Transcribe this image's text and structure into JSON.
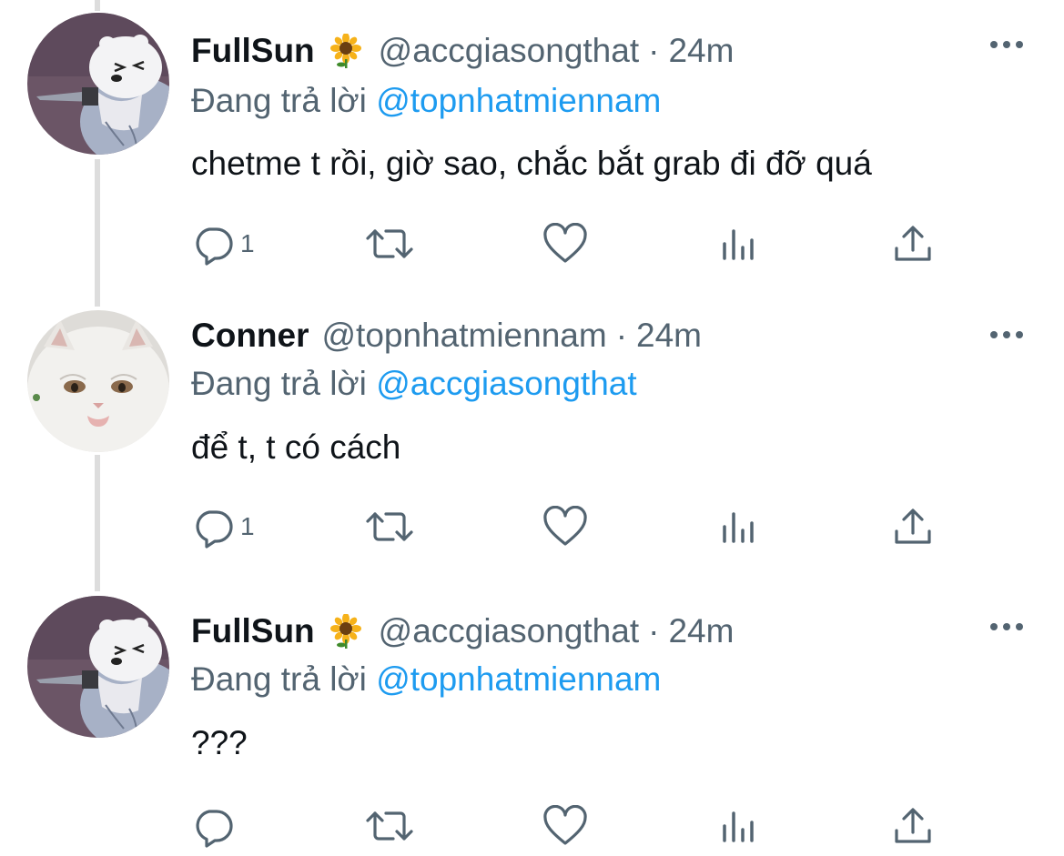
{
  "colors": {
    "text_primary": "#0f1419",
    "text_secondary": "#536471",
    "mention": "#1d9bf0",
    "thread_line": "#dddddd",
    "icon": "#536471"
  },
  "tweets": [
    {
      "display_name": "FullSun",
      "emoji": "sunflower-icon",
      "handle": "@accgiasongthat",
      "separator": "·",
      "time": "24m",
      "reply_prefix": "Đang trả lời",
      "reply_to": "@topnhatmiennam",
      "text": "chetme t rồi, giờ sao, chắc bắt grab đi đỡ quá",
      "reply_count": "1",
      "avatar": "bear-knife-avatar"
    },
    {
      "display_name": "Conner",
      "emoji": "",
      "handle": "@topnhatmiennam",
      "separator": "·",
      "time": "24m",
      "reply_prefix": "Đang trả lời",
      "reply_to": "@accgiasongthat",
      "text": "để t, t có cách",
      "reply_count": "1",
      "avatar": "white-cat-avatar"
    },
    {
      "display_name": "FullSun",
      "emoji": "sunflower-icon",
      "handle": "@accgiasongthat",
      "separator": "·",
      "time": "24m",
      "reply_prefix": "Đang trả lời",
      "reply_to": "@topnhatmiennam",
      "text": "???",
      "reply_count": "",
      "avatar": "bear-knife-avatar"
    }
  ]
}
